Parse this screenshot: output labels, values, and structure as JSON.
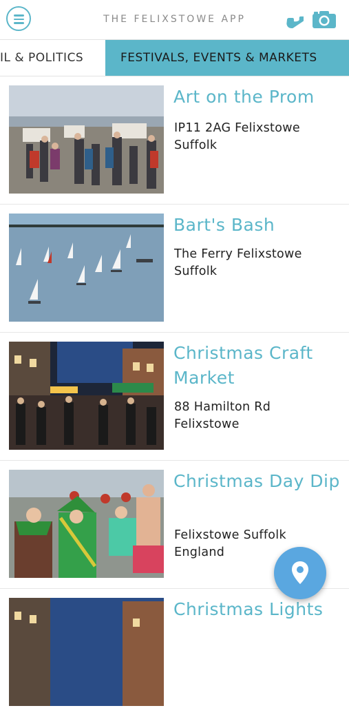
{
  "header": {
    "title": "THE FELIXSTOWE APP",
    "menu_icon": "hamburger-menu-icon",
    "phone_icon": "phone-icon",
    "camera_icon": "camera-icon",
    "accent_color": "#5bb6c9"
  },
  "tabs": [
    {
      "label": "IL & POLITICS",
      "selected": false
    },
    {
      "label": "FESTIVALS, EVENTS & MARKETS",
      "selected": true
    }
  ],
  "listings": [
    {
      "title": "Art on the Prom",
      "address": "IP11 2AG Felixstowe\nSuffolk"
    },
    {
      "title": "Bart's Bash",
      "address": "The Ferry Felixstowe\nSuffolk"
    },
    {
      "title": "Christmas Craft Market",
      "address": "88 Hamilton Rd\nFelixstowe"
    },
    {
      "title": "Christmas Day Dip",
      "address": "Felixstowe Suffolk\nEngland"
    },
    {
      "title": "Christmas Lights",
      "address": ""
    }
  ],
  "fab": {
    "icon": "map-pin-icon",
    "color": "#5aa7e0"
  }
}
